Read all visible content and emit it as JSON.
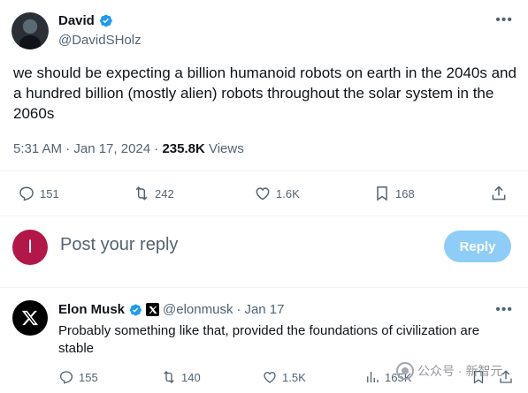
{
  "tweet": {
    "author_name": "David",
    "author_handle": "@DavidSHolz",
    "text": "we should be expecting a billion humanoid robots on earth in the 2040s and a hundred billion (mostly alien) robots throughout the solar system in the 2060s",
    "time": "5:31 AM · Jan 17, 2024 · ",
    "views_count": "235.8K",
    "views_label": " Views",
    "replies": "151",
    "reposts": "242",
    "likes": "1.6K",
    "bookmarks": "168"
  },
  "composer": {
    "avatar_letter": "I",
    "placeholder": "Post your reply",
    "button_label": "Reply"
  },
  "reply": {
    "author_name": "Elon Musk",
    "author_handle": "@elonmusk",
    "dot": "·",
    "date": "Jan 17",
    "text": "Probably something like that, provided the foundations of civilization are stable",
    "replies": "155",
    "reposts": "140",
    "likes": "1.5K",
    "views": "165K"
  },
  "watermark": {
    "text": "公众号 · 新智元"
  },
  "colors": {
    "verified_blue": "#1d9bf0",
    "secondary_text": "#536471",
    "reply_button": "#8ecdf8",
    "composer_avatar": "#b3174a"
  }
}
